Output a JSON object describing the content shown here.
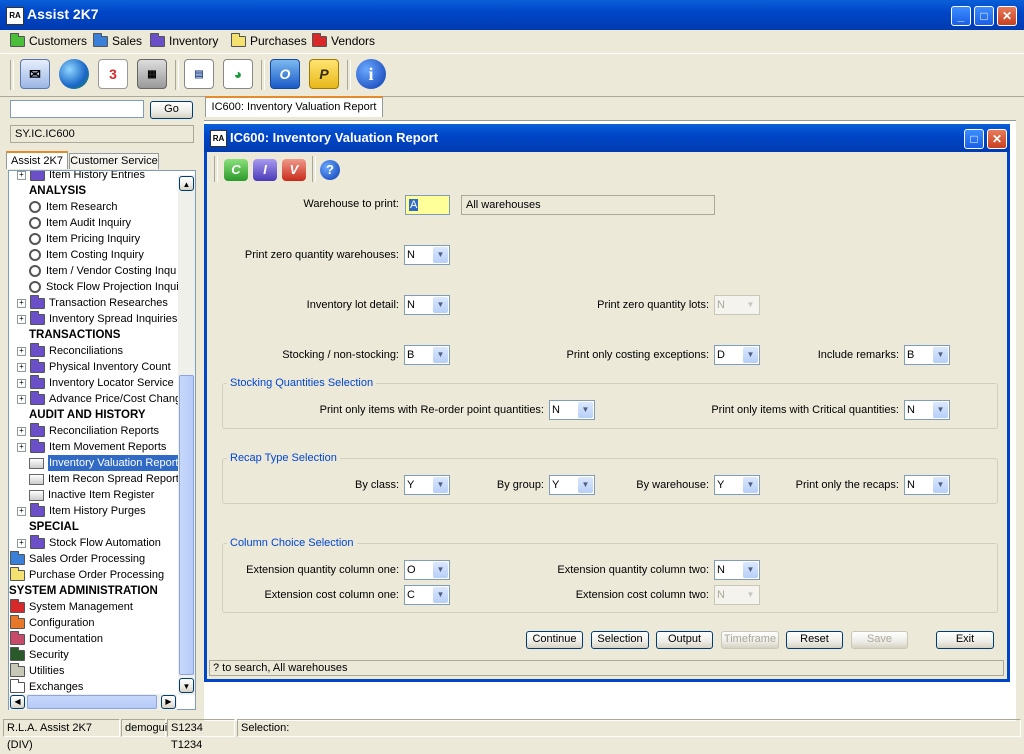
{
  "app": {
    "title": "Assist  2K7",
    "logo": "RA"
  },
  "menu": [
    {
      "label": "Customers",
      "color": "#4bbf3a"
    },
    {
      "label": "Sales",
      "color": "#3a7fd8"
    },
    {
      "label": "Inventory",
      "color": "#6a4fc8"
    },
    {
      "label": "Purchases",
      "color": "#f5e170"
    },
    {
      "label": "Vendors",
      "color": "#d8282a"
    }
  ],
  "toolbar_icons": [
    "mail-icon",
    "globe-icon",
    "calendar-icon",
    "calculator-icon",
    "document-icon",
    "chart-icon",
    "outlook-icon",
    "publisher-icon",
    "info-icon"
  ],
  "left": {
    "go_label": "Go",
    "path": "SY.IC.IC600",
    "tabs": [
      "Assist 2K7",
      "Customer Service"
    ],
    "tree": [
      {
        "label": "Item History Entries",
        "type": "folder",
        "indent": 1,
        "color": "#6a4fc8",
        "expander": true
      },
      {
        "label": "ANALYSIS",
        "type": "section",
        "indent": 1
      },
      {
        "label": "Item Research",
        "type": "search",
        "indent": 2
      },
      {
        "label": "Item Audit Inquiry",
        "type": "search",
        "indent": 2
      },
      {
        "label": "Item Pricing Inquiry",
        "type": "search",
        "indent": 2
      },
      {
        "label": "Item Costing Inquiry",
        "type": "search",
        "indent": 2
      },
      {
        "label": "Item / Vendor Costing Inqu",
        "type": "search",
        "indent": 2
      },
      {
        "label": "Stock Flow Projection Inqui",
        "type": "search",
        "indent": 2
      },
      {
        "label": "Transaction Researches",
        "type": "folder",
        "indent": 1,
        "color": "#6a4fc8",
        "expander": true
      },
      {
        "label": "Inventory Spread Inquiries",
        "type": "folder",
        "indent": 1,
        "color": "#6a4fc8",
        "expander": true
      },
      {
        "label": "TRANSACTIONS",
        "type": "section",
        "indent": 1
      },
      {
        "label": "Reconciliations",
        "type": "folder",
        "indent": 1,
        "color": "#6a4fc8",
        "expander": true
      },
      {
        "label": "Physical Inventory Count",
        "type": "folder",
        "indent": 1,
        "color": "#6a4fc8",
        "expander": true
      },
      {
        "label": "Inventory Locator Service",
        "type": "folder",
        "indent": 1,
        "color": "#6a4fc8",
        "expander": true
      },
      {
        "label": "Advance Price/Cost Chang",
        "type": "folder",
        "indent": 1,
        "color": "#6a4fc8",
        "expander": true
      },
      {
        "label": "AUDIT AND HISTORY",
        "type": "section",
        "indent": 1
      },
      {
        "label": "Reconciliation Reports",
        "type": "folder",
        "indent": 1,
        "color": "#6a4fc8",
        "expander": true
      },
      {
        "label": "Item Movement Reports",
        "type": "folder",
        "indent": 1,
        "color": "#6a4fc8",
        "expander": true
      },
      {
        "label": "Inventory Valuation Report",
        "type": "printer",
        "indent": 2,
        "selected": true
      },
      {
        "label": "Item Recon Spread Report",
        "type": "printer",
        "indent": 2
      },
      {
        "label": "Inactive Item Register",
        "type": "printer",
        "indent": 2
      },
      {
        "label": "Item History Purges",
        "type": "folder",
        "indent": 1,
        "color": "#6a4fc8",
        "expander": true
      },
      {
        "label": "SPECIAL",
        "type": "section",
        "indent": 1
      },
      {
        "label": "Stock Flow Automation",
        "type": "folder",
        "indent": 1,
        "color": "#6a4fc8",
        "expander": true
      },
      {
        "label": "Sales Order Processing",
        "type": "folder",
        "indent": 0,
        "color": "#3a7fd8"
      },
      {
        "label": "Purchase Order Processing",
        "type": "folder",
        "indent": 0,
        "color": "#f5e170"
      },
      {
        "label": "SYSTEM ADMINISTRATION",
        "type": "section",
        "indent": 0
      },
      {
        "label": "System Management",
        "type": "folder",
        "indent": 0,
        "color": "#d8282a"
      },
      {
        "label": "Configuration",
        "type": "folder",
        "indent": 0,
        "color": "#e8772a"
      },
      {
        "label": "Documentation",
        "type": "folder",
        "indent": 0,
        "color": "#c84a6a"
      },
      {
        "label": "Security",
        "type": "folder",
        "indent": 0,
        "color": "#2a5a2a"
      },
      {
        "label": "Utilities",
        "type": "folder",
        "indent": 0,
        "color": "#c8c8b8"
      },
      {
        "label": "Exchanges",
        "type": "folder",
        "indent": 0,
        "color": "#ffffff"
      }
    ]
  },
  "doc_tab": "IC600: Inventory Valuation Report",
  "window": {
    "title": "IC600: Inventory Valuation Report",
    "tool_c": "C",
    "tool_i": "I",
    "tool_v": "V",
    "help": "?"
  },
  "form": {
    "warehouse_label": "Warehouse to print:",
    "warehouse_value": "A",
    "warehouse_desc": "All warehouses",
    "zero_qty_wh_label": "Print zero quantity warehouses:",
    "zero_qty_wh_value": "N",
    "lot_detail_label": "Inventory lot detail:",
    "lot_detail_value": "N",
    "zero_qty_lots_label": "Print zero quantity lots:",
    "zero_qty_lots_value": "N",
    "stocking_label": "Stocking / non-stocking:",
    "stocking_value": "B",
    "costing_exc_label": "Print only costing exceptions:",
    "costing_exc_value": "D",
    "remarks_label": "Include remarks:",
    "remarks_value": "B",
    "stocking_group": {
      "title": "Stocking Quantities Selection",
      "reorder_label": "Print only items with Re-order point quantities:",
      "reorder_value": "N",
      "critical_label": "Print only items with Critical quantities:",
      "critical_value": "N"
    },
    "recap_group": {
      "title": "Recap Type Selection",
      "class_label": "By class:",
      "class_value": "Y",
      "group_label": "By group:",
      "group_value": "Y",
      "warehouse_label": "By warehouse:",
      "warehouse_value": "Y",
      "recaps_label": "Print only the recaps:",
      "recaps_value": "N"
    },
    "column_group": {
      "title": "Column Choice Selection",
      "ext_qty_one_label": "Extension quantity column one:",
      "ext_qty_one_value": "O",
      "ext_qty_two_label": "Extension quantity column two:",
      "ext_qty_two_value": "N",
      "ext_cost_one_label": "Extension cost column one:",
      "ext_cost_one_value": "C",
      "ext_cost_two_label": "Extension cost column two:",
      "ext_cost_two_value": "N"
    }
  },
  "buttons": {
    "continue": "Continue",
    "selection": "Selection",
    "output": "Output",
    "timeframe": "Timeframe",
    "reset": "Reset",
    "save": "Save",
    "exit": "Exit"
  },
  "status_hint": "? to search,  All warehouses",
  "statusbar": {
    "app": "R.L.A. Assist 2K7 (DIV)",
    "user": "demogui",
    "session": "S1234 T1234",
    "selection": "Selection:"
  }
}
